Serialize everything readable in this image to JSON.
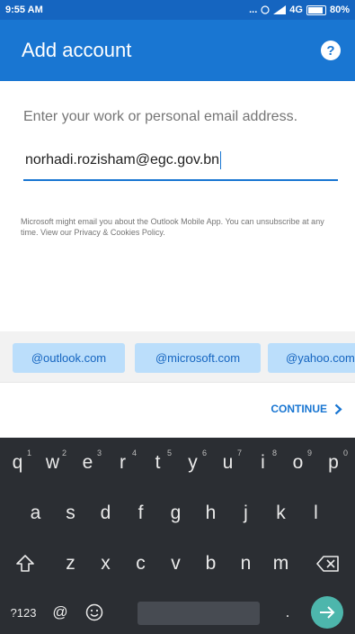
{
  "status_bar": {
    "time": "9:55 AM",
    "signal_dots": "...",
    "network": "4G",
    "battery": "80%"
  },
  "header": {
    "title": "Add account",
    "help_icon": "?"
  },
  "form": {
    "prompt": "Enter your work or personal email address.",
    "email_value": "norhadi.rozisham@egc.gov.bn",
    "disclaimer": "Microsoft might email you about the Outlook Mobile App. You can unsubscribe at any time. View our Privacy & Cookies Policy."
  },
  "domain_suggestions": [
    "@outlook.com",
    "@microsoft.com",
    "@yahoo.com"
  ],
  "actions": {
    "continue_label": "CONTINUE",
    "continue_icon": "chevron-right"
  },
  "keyboard": {
    "row1": [
      {
        "key": "q",
        "hint": "1"
      },
      {
        "key": "w",
        "hint": "2"
      },
      {
        "key": "e",
        "hint": "3"
      },
      {
        "key": "r",
        "hint": "4"
      },
      {
        "key": "t",
        "hint": "5"
      },
      {
        "key": "y",
        "hint": "6"
      },
      {
        "key": "u",
        "hint": "7"
      },
      {
        "key": "i",
        "hint": "8"
      },
      {
        "key": "o",
        "hint": "9"
      },
      {
        "key": "p",
        "hint": "0"
      }
    ],
    "row2": [
      "a",
      "s",
      "d",
      "f",
      "g",
      "h",
      "j",
      "k",
      "l"
    ],
    "row3": [
      "z",
      "x",
      "c",
      "v",
      "b",
      "n",
      "m"
    ],
    "mode_key": "?123",
    "at_key": "@",
    "period_key": ".",
    "shift_icon": "shift-icon",
    "backspace_icon": "backspace-icon",
    "emoji_icon": "emoji-icon",
    "enter_icon": "arrow-right-icon"
  },
  "colors": {
    "status_bar": "#1565c0",
    "app_bar": "#1976d2",
    "chip_bg": "#bbdefb",
    "keyboard_bg": "#2b2e33",
    "enter_key": "#4db6ac"
  }
}
